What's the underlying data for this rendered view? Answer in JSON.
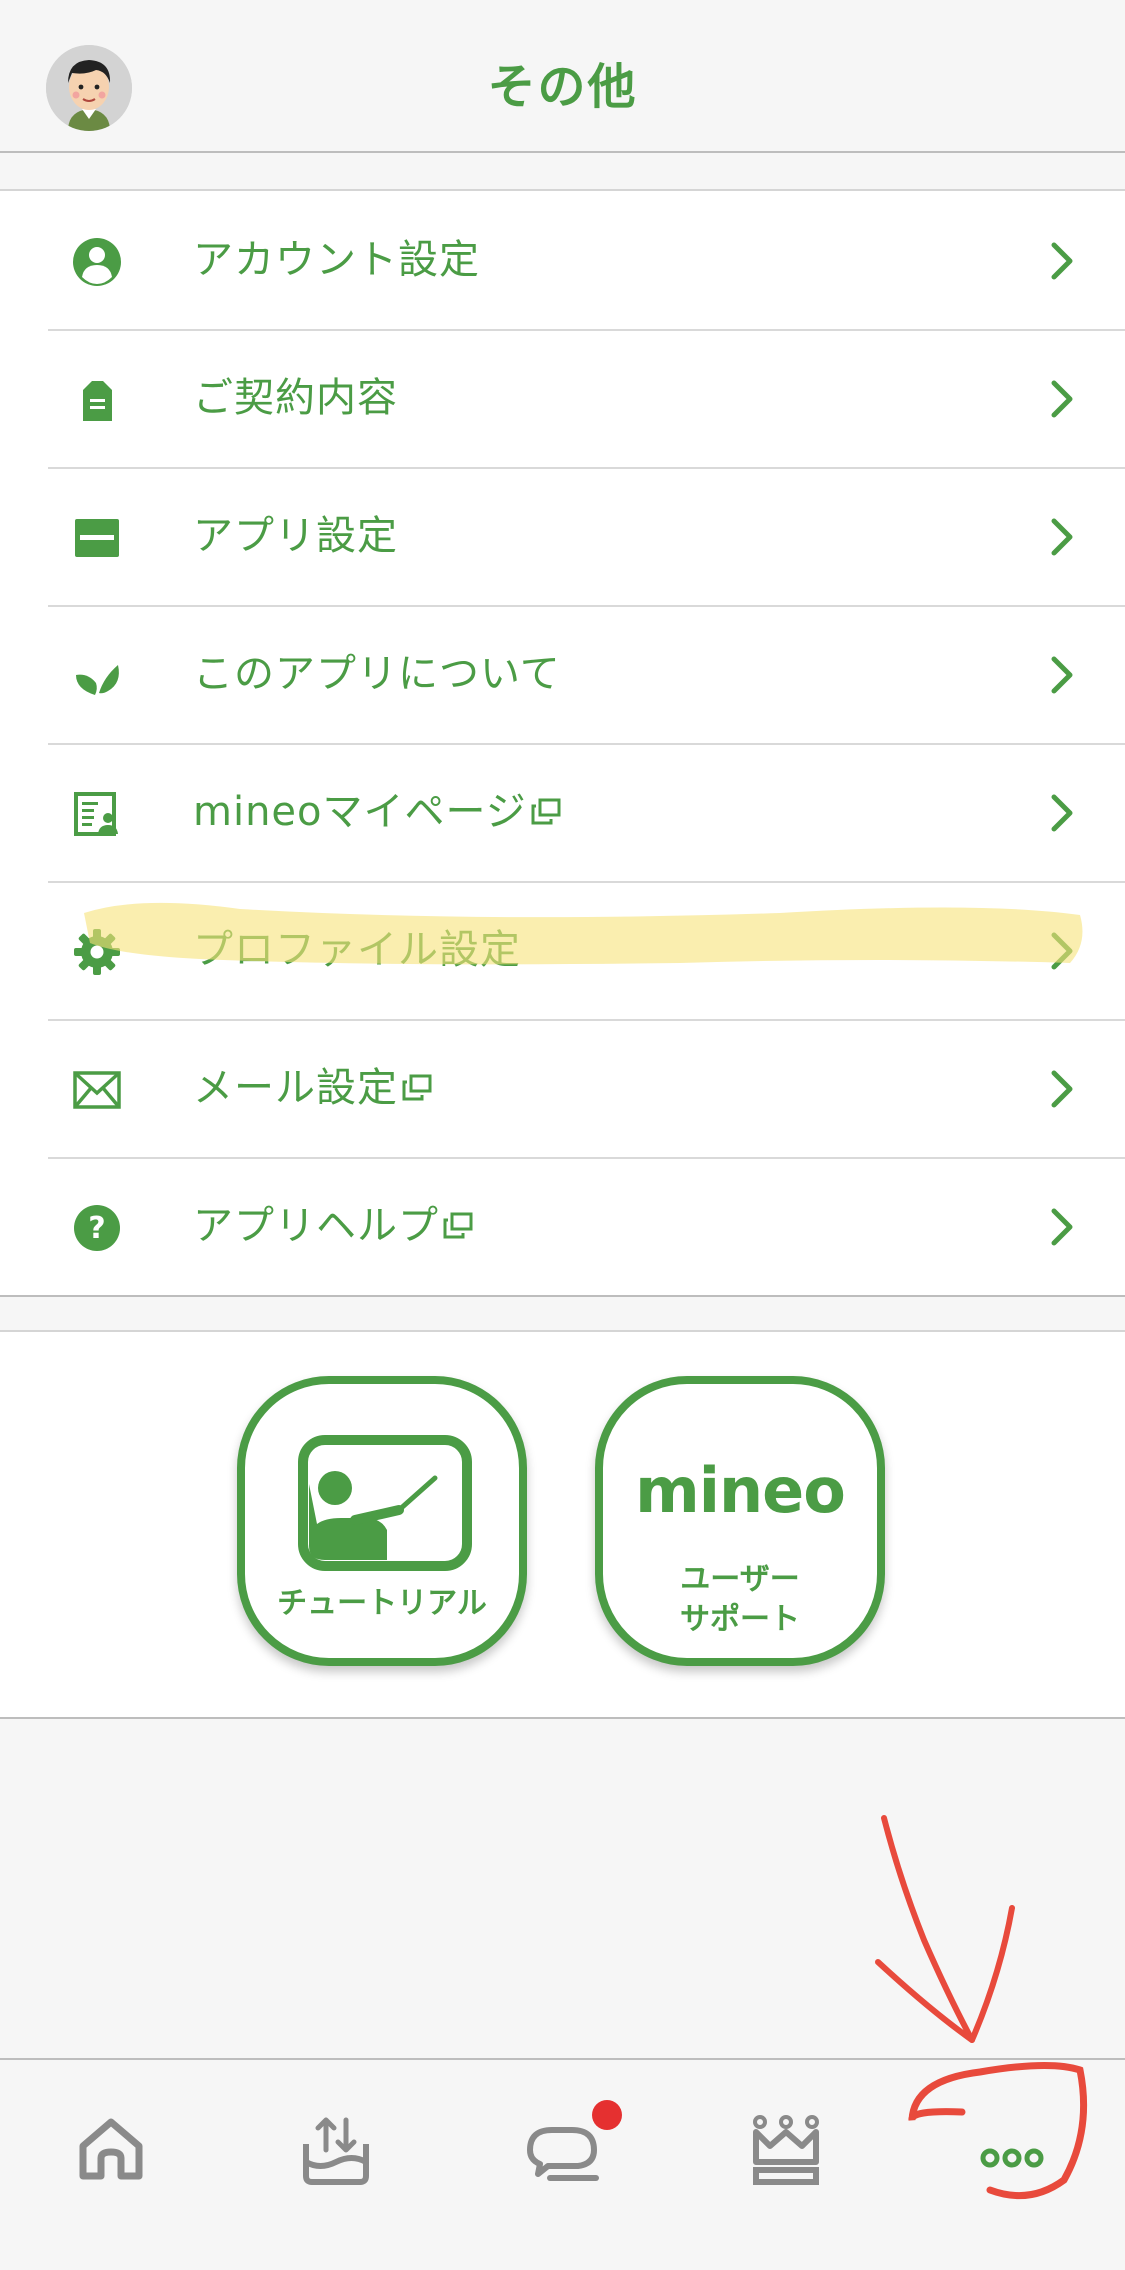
{
  "header": {
    "title": "その他"
  },
  "menu": {
    "items": [
      {
        "label": "アカウント設定",
        "icon": "account-icon",
        "external": false
      },
      {
        "label": "ご契約内容",
        "icon": "contract-document-icon",
        "external": false
      },
      {
        "label": "アプリ設定",
        "icon": "app-settings-icon",
        "external": false
      },
      {
        "label": "このアプリについて",
        "icon": "about-leaf-icon",
        "external": false
      },
      {
        "label": "mineoマイページ",
        "icon": "mypage-icon",
        "external": true
      },
      {
        "label": "プロファイル設定",
        "icon": "gear-icon",
        "external": false
      },
      {
        "label": "メール設定",
        "icon": "mail-icon",
        "external": true
      },
      {
        "label": "アプリヘルプ",
        "icon": "help-icon",
        "external": true
      }
    ]
  },
  "cards": {
    "tutorial_label": "チュートリアル",
    "logo": "mineo",
    "support_line1": "ユーザー",
    "support_line2": "サポート"
  },
  "tabbar": {
    "tabs": [
      {
        "icon": "home-icon"
      },
      {
        "icon": "data-share-icon"
      },
      {
        "icon": "chat-icon",
        "badge": true
      },
      {
        "icon": "crown-ranking-icon"
      },
      {
        "icon": "more-dots-icon",
        "active": true
      }
    ]
  },
  "colors": {
    "accent": "#4b9c45",
    "background": "#f6f6f6",
    "badge": "#e53030",
    "highlight": "#f7e27a",
    "annotation": "#e84a3c"
  }
}
